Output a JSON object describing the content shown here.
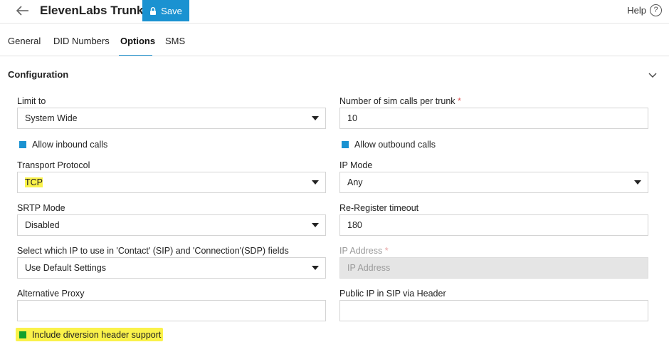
{
  "header": {
    "title": "ElevenLabs Trunk",
    "save_label": "Save",
    "help_label": "Help",
    "help_icon_glyph": "?"
  },
  "tabs": [
    {
      "label": "General",
      "active": false
    },
    {
      "label": "DID Numbers",
      "active": false
    },
    {
      "label": "Options",
      "active": true
    },
    {
      "label": "SMS",
      "active": false
    }
  ],
  "section": {
    "title": "Configuration"
  },
  "form": {
    "limit_to": {
      "label": "Limit to",
      "value": "System Wide"
    },
    "sim_calls": {
      "label": "Number of sim calls per trunk",
      "required_mark": "*",
      "value": "10"
    },
    "allow_inbound": {
      "label": "Allow inbound calls",
      "checked": true
    },
    "allow_outbound": {
      "label": "Allow outbound calls",
      "checked": true
    },
    "transport_protocol": {
      "label": "Transport Protocol",
      "value": "TCP",
      "highlighted": true
    },
    "ip_mode": {
      "label": "IP Mode",
      "value": "Any"
    },
    "srtp_mode": {
      "label": "SRTP Mode",
      "value": "Disabled"
    },
    "reregister_timeout": {
      "label": "Re-Register timeout",
      "value": "180"
    },
    "contact_ip": {
      "label": "Select which IP to use in 'Contact' (SIP) and 'Connection'(SDP) fields",
      "value": "Use Default Settings"
    },
    "ip_address": {
      "label": "IP Address",
      "required_mark": "*",
      "placeholder": "IP Address",
      "disabled": true
    },
    "alternative_proxy": {
      "label": "Alternative Proxy",
      "value": ""
    },
    "public_ip_header": {
      "label": "Public IP in SIP via Header",
      "value": ""
    },
    "diversion_header": {
      "label": "Include diversion header support",
      "checked": true,
      "highlighted": true
    }
  },
  "colors": {
    "accent": "#1a92d1",
    "highlight": "#faf24a",
    "checkbox_green": "#12a12d",
    "disabled_field": "#e5e5e5"
  },
  "icons": [
    "back-arrow-icon",
    "lock-icon",
    "help-circle-icon",
    "chevron-down-icon",
    "dropdown-caret-icon"
  ]
}
